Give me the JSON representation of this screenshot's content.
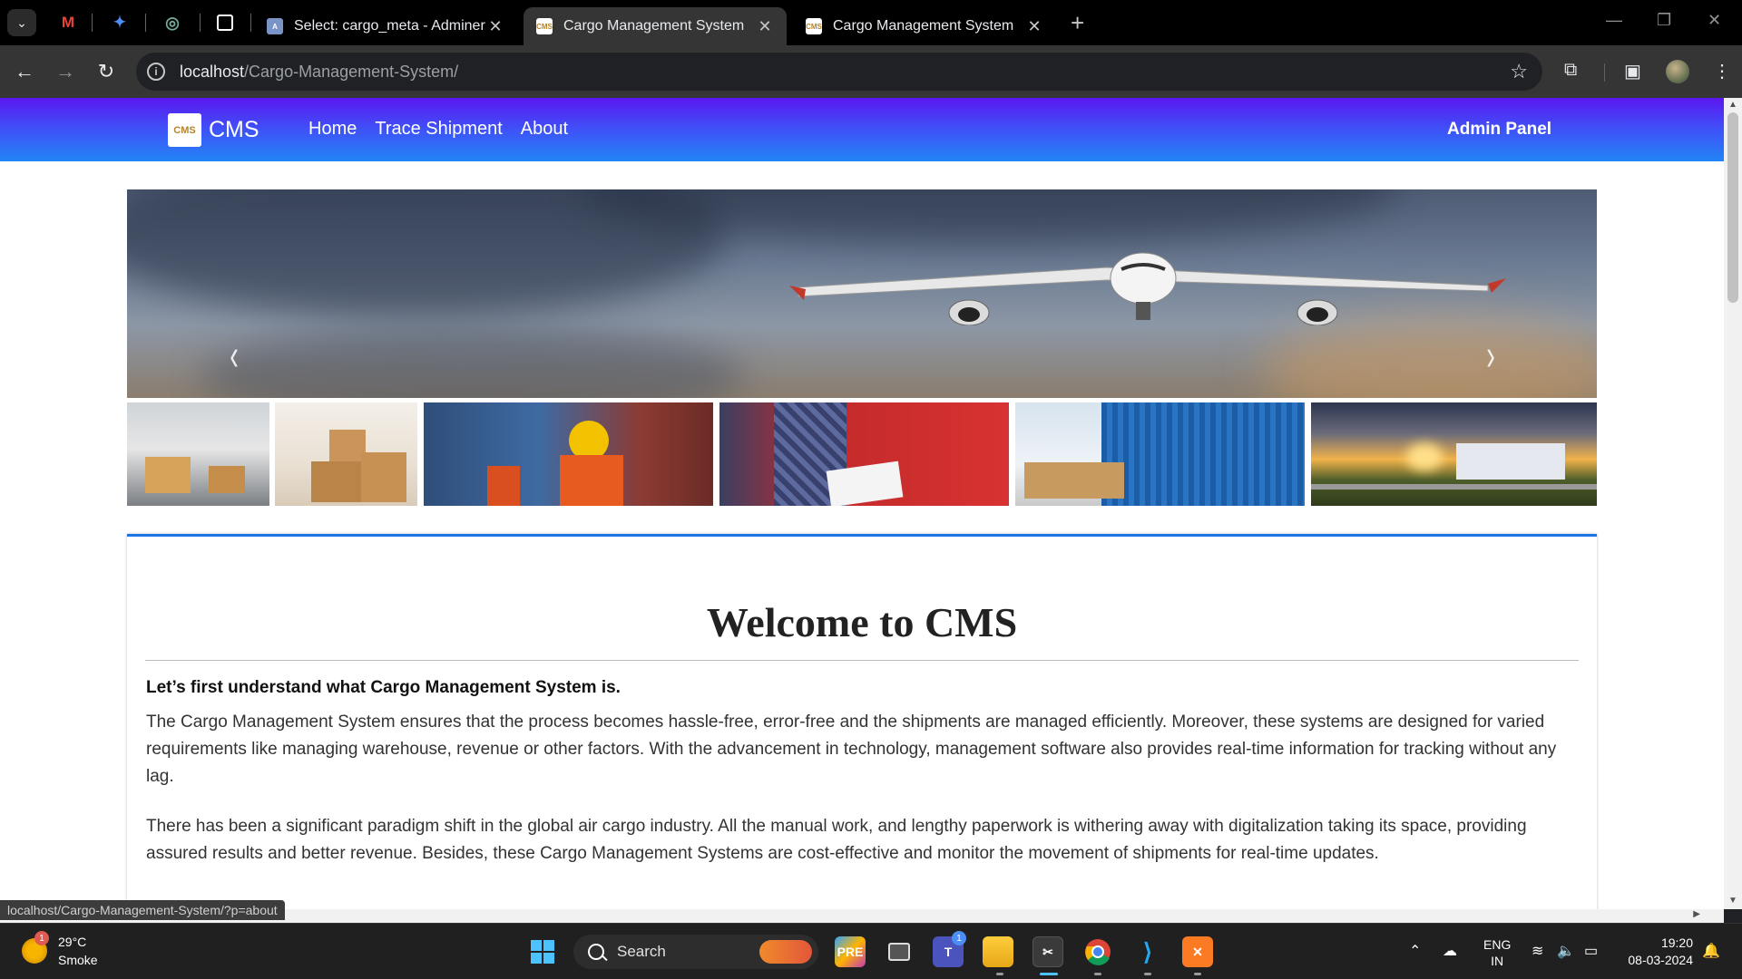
{
  "browser": {
    "tabs": [
      {
        "title": "Select: cargo_meta - Adminer",
        "active": false
      },
      {
        "title": "Cargo Management System",
        "active": true
      },
      {
        "title": "Cargo Management System",
        "active": false
      }
    ],
    "url_host": "localhost",
    "url_path": "/Cargo-Management-System/",
    "status_url": "localhost/Cargo-Management-System/?p=about"
  },
  "site": {
    "brand_logo_text": "CMS",
    "brand": "CMS",
    "nav": [
      "Home",
      "Trace Shipment",
      "About"
    ],
    "admin_link": "Admin Panel",
    "carousel_prev": "‹",
    "carousel_next": "›"
  },
  "content": {
    "heading": "Welcome to CMS",
    "lead": "Let’s first understand what Cargo Management System is.",
    "paragraphs": [
      "The Cargo Management System ensures that the process becomes hassle-free, error-free and the shipments are managed efficiently. Moreover, these systems are designed for varied requirements like managing warehouse, revenue or other factors. With the advancement in technology, management software also provides real-time information for tracking without any lag.",
      "There has been a significant paradigm shift in the global air cargo industry. All the manual work, and lengthy paperwork is withering away with digitalization taking its space, providing assured results and better revenue. Besides, these Cargo Management Systems are cost-effective and monitor the movement of shipments for real-time updates."
    ]
  },
  "taskbar": {
    "weather_temp": "29°C",
    "weather_desc": "Smoke",
    "weather_badge": "1",
    "search_label": "Search",
    "teams_badge": "1",
    "lang_line1": "ENG",
    "lang_line2": "IN",
    "time": "19:20",
    "date": "08-03-2024"
  },
  "colors": {
    "navbar_top": "#5a17f0",
    "navbar_bottom": "#2185f6",
    "card_accent": "#1b74e4"
  }
}
